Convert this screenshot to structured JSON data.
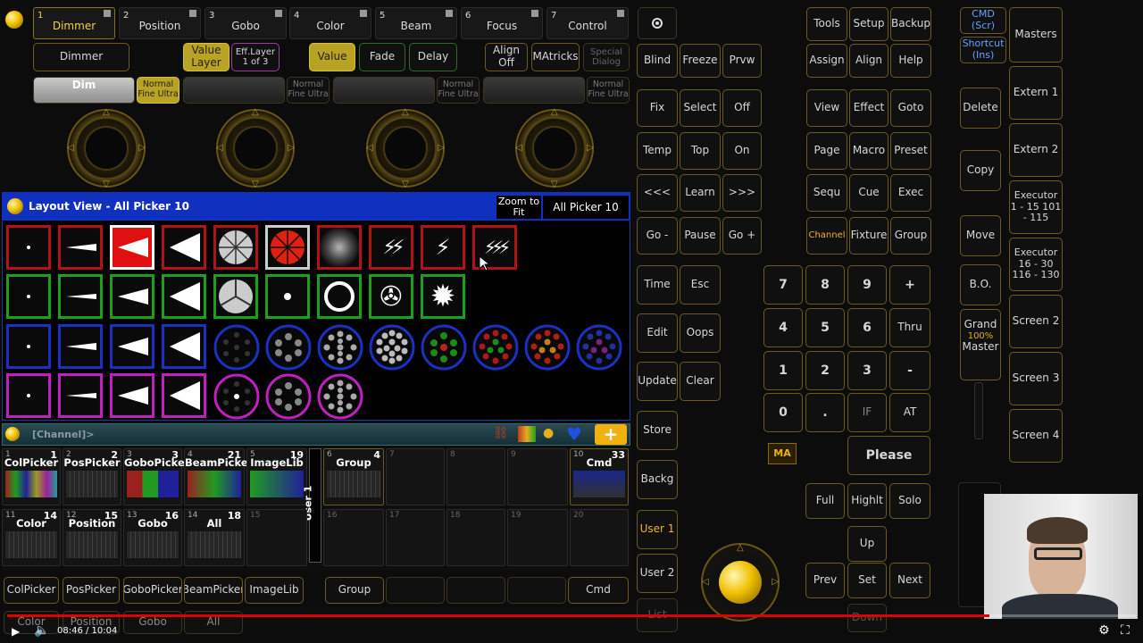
{
  "encoder_tabs": [
    {
      "num": "1",
      "label": "Dimmer"
    },
    {
      "num": "2",
      "label": "Position"
    },
    {
      "num": "3",
      "label": "Gobo"
    },
    {
      "num": "4",
      "label": "Color"
    },
    {
      "num": "5",
      "label": "Beam"
    },
    {
      "num": "6",
      "label": "Focus"
    },
    {
      "num": "7",
      "label": "Control"
    }
  ],
  "encoder_bar": {
    "dimmer": "Dimmer",
    "value_layer": "Value Layer",
    "eff_layer": "Eff.Layer 1 of 3",
    "value": "Value",
    "fade": "Fade",
    "delay": "Delay",
    "align_off": "Align Off",
    "matricks": "MAtricks",
    "special_dialog": "Special Dialog",
    "dim_slot": "Dim",
    "res": "Normal Fine Ultra"
  },
  "layout_view": {
    "title": "Layout View - All Picker 10",
    "zoom": "Zoom to Fit",
    "picker": "All Picker 10"
  },
  "command_line": {
    "text": "[Channel]>",
    "plus": "+"
  },
  "pools_row1": [
    {
      "num": "1",
      "id": "1",
      "label": "ColPicker"
    },
    {
      "num": "2",
      "id": "2",
      "label": "PosPicker"
    },
    {
      "num": "3",
      "id": "3",
      "label": "GoboPicke"
    },
    {
      "num": "4",
      "id": "21",
      "label": "BeamPicke"
    },
    {
      "num": "5",
      "id": "19",
      "label": "ImageLib"
    }
  ],
  "pools_row1b": [
    {
      "num": "6",
      "id": "4",
      "label": "Group"
    },
    {
      "num": "7",
      "id": "",
      "label": ""
    },
    {
      "num": "8",
      "id": "",
      "label": ""
    },
    {
      "num": "9",
      "id": "",
      "label": ""
    },
    {
      "num": "10",
      "id": "33",
      "label": "Cmd"
    }
  ],
  "pools_row2": [
    {
      "num": "11",
      "id": "14",
      "label": "Color"
    },
    {
      "num": "12",
      "id": "15",
      "label": "Position"
    },
    {
      "num": "13",
      "id": "16",
      "label": "Gobo"
    },
    {
      "num": "14",
      "id": "18",
      "label": "All"
    },
    {
      "num": "15",
      "id": "",
      "label": ""
    }
  ],
  "pools_row2b": [
    {
      "num": "16",
      "id": "",
      "label": ""
    },
    {
      "num": "17",
      "id": "",
      "label": ""
    },
    {
      "num": "18",
      "id": "",
      "label": ""
    },
    {
      "num": "19",
      "id": "",
      "label": ""
    },
    {
      "num": "20",
      "id": "",
      "label": ""
    }
  ],
  "user_tab": "User 1",
  "bottom_row1": [
    "ColPicker",
    "PosPicker",
    "GoboPicker",
    "BeamPicker",
    "ImageLib",
    "",
    "Group",
    "",
    "",
    "",
    "Cmd"
  ],
  "bottom_row2": [
    "Color",
    "Position",
    "Gobo",
    "All"
  ],
  "keys_col1": [
    "Blind",
    "Fix",
    "Temp",
    "<<<",
    "Go -",
    "Time",
    "Edit",
    "Update",
    "Store",
    "Backg",
    "User 1",
    "User 2",
    "List"
  ],
  "keys_col2": [
    "Freeze",
    "Select",
    "Top",
    "Learn",
    "Pause",
    "Esc",
    "Oops",
    "Clear"
  ],
  "keys_col3": [
    "Prvw",
    "Off",
    "On",
    ">>>",
    "Go +"
  ],
  "keys_right1": [
    "Tools",
    "Assign",
    "View",
    "Page",
    "Sequ",
    "Channel"
  ],
  "keys_right2": [
    "Setup",
    "Align",
    "Effect",
    "Macro",
    "Cue",
    "Fixture"
  ],
  "keys_right3": [
    "Backup",
    "Help",
    "Goto",
    "Preset",
    "Exec",
    "Group"
  ],
  "numpad": [
    "7",
    "8",
    "9",
    "+",
    "4",
    "5",
    "6",
    "Thru",
    "1",
    "2",
    "3",
    "-",
    "0",
    ".",
    "IF",
    "AT"
  ],
  "please": "Please",
  "ma_logo": "MA",
  "bottom_keys": [
    "Full",
    "Highlt",
    "Solo",
    "Up",
    "Prev",
    "Set",
    "Next",
    "Down"
  ],
  "side_col": [
    "CMD (Scr)",
    "Shortcut (Ins)",
    "Delete",
    "Copy",
    "Move",
    "B.O.",
    "Grand",
    "100%",
    "Master"
  ],
  "masters": [
    "Masters",
    "Extern 1",
    "Extern 2",
    "Executor 1 - 15 101 - 115",
    "Executor 16 - 30 116 - 130",
    "Screen 2",
    "Screen 3",
    "Screen 4"
  ],
  "video": {
    "time": "08:46 / 10:04",
    "progress": 0.87
  }
}
